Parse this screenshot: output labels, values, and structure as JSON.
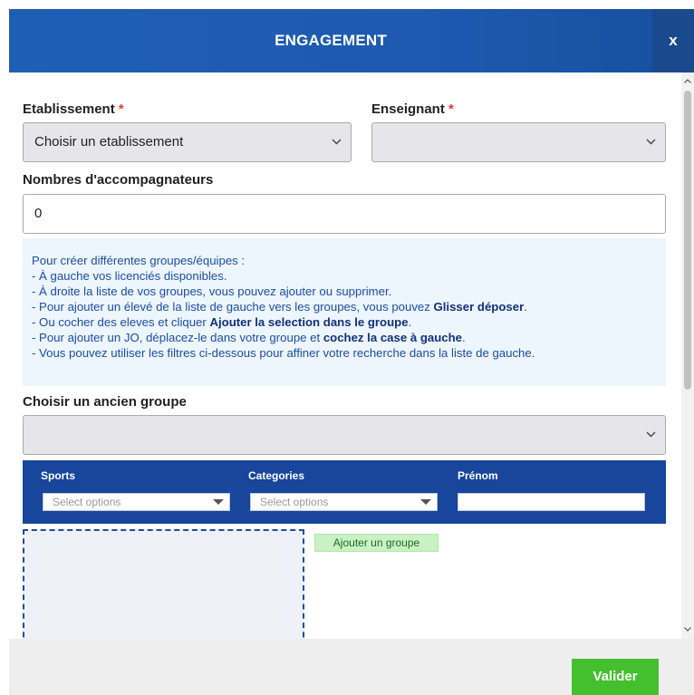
{
  "header": {
    "title": "ENGAGEMENT",
    "close_label": "x"
  },
  "form": {
    "etablissement": {
      "label": "Etablissement",
      "required_mark": "*",
      "value": "Choisir un etablissement"
    },
    "enseignant": {
      "label": "Enseignant",
      "required_mark": "*",
      "value": ""
    },
    "accompagnateurs": {
      "label": "Nombres d'accompagnateurs",
      "value": "0"
    },
    "ancien_groupe": {
      "label": "Choisir un ancien groupe",
      "value": ""
    }
  },
  "info": {
    "line1": "Pour créer différentes groupes/équipes :",
    "line2": "- À gauche vos licenciés disponibles.",
    "line3": "- À droite la liste de vos groupes, vous pouvez ajouter ou supprimer.",
    "line4_pre": "- Pour ajouter un élevé de la liste de gauche vers les groupes, vous pouvez ",
    "line4_bold": "Glisser déposer",
    "line4_post": ".",
    "line5_pre": "- Ou cocher des eleves et cliquer ",
    "line5_bold": "Ajouter la selection dans le groupe",
    "line5_post": ".",
    "line6_pre": "- Pour ajouter un JO, déplacez-le dans votre groupe et ",
    "line6_bold": "cochez la case à gauche",
    "line6_post": ".",
    "line7": "- Vous pouvez utiliser les filtres ci-dessous pour affiner votre recherche dans la liste de gauche."
  },
  "filters": {
    "sports": {
      "label": "Sports",
      "placeholder": "Select options"
    },
    "categories": {
      "label": "Categories",
      "placeholder": "Select options"
    },
    "prenom": {
      "label": "Prénom",
      "value": ""
    }
  },
  "groups": {
    "add_label": "Ajouter un groupe"
  },
  "footer": {
    "submit_label": "Valider"
  },
  "icons": {
    "select_chevron": "chevron-down-icon",
    "filter_caret": "caret-down-icon"
  },
  "colors": {
    "header": "#1e5fb4",
    "filter_bar": "#17469c",
    "submit": "#44c02e",
    "required": "#e53935"
  }
}
